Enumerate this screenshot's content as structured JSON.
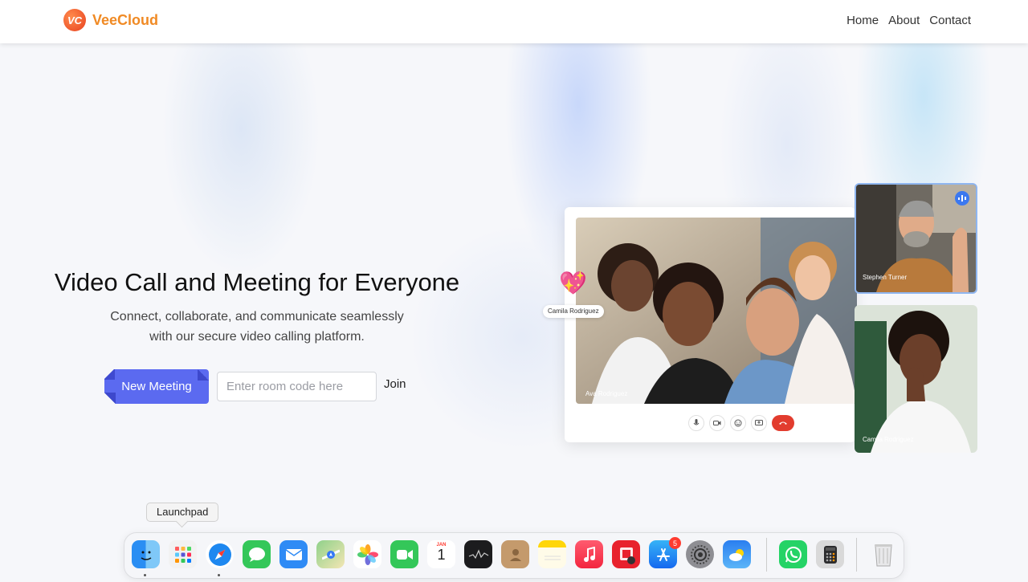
{
  "header": {
    "brand_name": "VeeCloud",
    "logo_text": "VC",
    "nav": [
      "Home",
      "About",
      "Contact"
    ]
  },
  "hero": {
    "title": "Video Call and Meeting for Everyone",
    "subtitle_line1": "Connect, collaborate, and communicate seamlessly",
    "subtitle_line2": "with our secure video calling platform.",
    "new_meeting_label": "New Meeting",
    "room_placeholder": "Enter room code here",
    "join_label": "Join"
  },
  "call_preview": {
    "main_label": "Ava Rodriguez",
    "chip_name": "Camila Rodriguez",
    "thumb1_name": "Stephen Turner",
    "thumb2_name": "Camila Rodriguez",
    "reaction_emoji": "💖"
  },
  "dock": {
    "tooltip": "Launchpad",
    "app_store_badge": "5",
    "calendar_month": "JAN",
    "calendar_day": "1",
    "apps": [
      "finder",
      "launchpad",
      "safari",
      "messages",
      "mail",
      "maps",
      "photos",
      "facetime",
      "calendar",
      "stocks",
      "contacts",
      "notes",
      "music",
      "photo-booth",
      "app-store",
      "system-settings",
      "weather",
      "whatsapp",
      "calculator",
      "trash"
    ]
  }
}
